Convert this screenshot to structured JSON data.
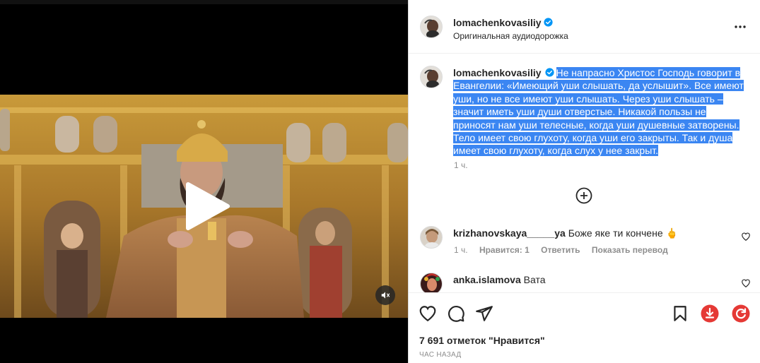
{
  "post": {
    "username": "lomachenkovasiliy",
    "audio": "Оригинальная аудиодорожка",
    "caption": "Не напрасно Христос Господь говорит в Евангелии: «Имеющий уши слышать, да услышит». Все имеют уши, но не все имеют уши слышать. Через уши слышать – значит иметь уши души отверстые. Никакой пользы не приносят нам уши телесные, когда уши душевные затворены. Тело имеет свою глухоту, когда уши его закрыты. Так и душа имеет свою глухоту, когда слух у нее закрыт.",
    "caption_time": "1 ч.",
    "likes_text": "7 691 отметок \"Нравится\"",
    "posted_ago": "ЧАС НАЗАД"
  },
  "comments": [
    {
      "username": "krizhanovskaya_____ya",
      "text": "Боже яке ти кончене 🖕",
      "time": "1 ч.",
      "likes": "Нравится: 1",
      "reply": "Ответить",
      "translate": "Показать перевод"
    },
    {
      "username": "anka.islamova",
      "text": "Вата"
    }
  ],
  "icons": {
    "verified": "verified-badge-icon",
    "more": "more-options-icon",
    "add_comments": "plus-circle-icon",
    "like": "heart-icon",
    "comment": "comment-icon",
    "share": "share-icon",
    "save": "bookmark-icon",
    "download": "download-extension-icon",
    "refresh": "refresh-extension-icon",
    "play": "play-icon",
    "mute": "mute-icon"
  },
  "colors": {
    "verified": "#0095f6",
    "selection": "#3b86f2",
    "extension": "#e53935"
  }
}
